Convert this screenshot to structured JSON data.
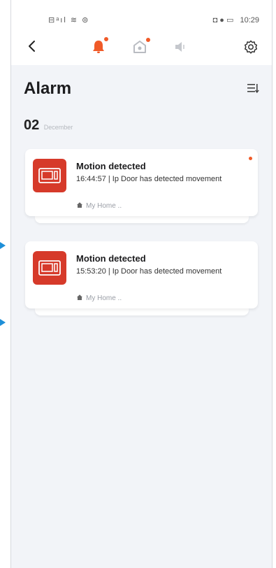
{
  "status_bar": {
    "left_icons": "⊟ᵃıl ≋ ⊜",
    "right_icons": "◘ ● ▭",
    "time": "10:29"
  },
  "nav": {
    "tabs": [
      "alarm-bell-icon",
      "doorbell-icon",
      "speaker-icon"
    ],
    "active_tab": "alarm-bell-icon",
    "accent_color": "#f05a28"
  },
  "page": {
    "title": "Alarm"
  },
  "date_group": {
    "day": "02",
    "month": "December"
  },
  "alarms": [
    {
      "title": "Motion detected",
      "description": "16:44:57 | Ip Door has detected movement",
      "home": "My Home ..",
      "unread": true
    },
    {
      "title": "Motion detected",
      "description": "15:53:20 | Ip Door has detected movement",
      "home": "My Home ..",
      "unread": false
    }
  ]
}
